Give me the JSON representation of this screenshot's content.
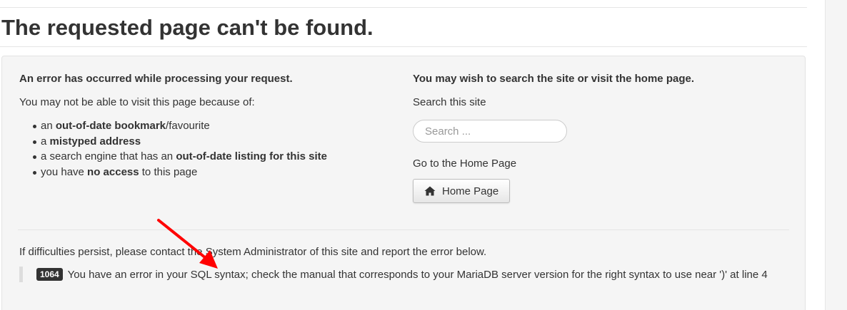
{
  "page": {
    "title": "The requested page can't be found."
  },
  "left_column": {
    "heading": "An error has occurred while processing your request.",
    "intro": "You may not be able to visit this page because of:",
    "reasons": [
      {
        "pre": "an ",
        "bold": "out-of-date bookmark",
        "post": "/favourite"
      },
      {
        "pre": "a ",
        "bold": "mistyped address",
        "post": ""
      },
      {
        "pre": "a search engine that has an ",
        "bold": "out-of-date listing for this site",
        "post": ""
      },
      {
        "pre": "you have ",
        "bold": "no access",
        "post": " to this page"
      }
    ]
  },
  "right_column": {
    "heading": "You may wish to search the site or visit the home page.",
    "search_label": "Search this site",
    "search_placeholder": "Search ...",
    "home_label": "Go to the Home Page",
    "home_button_label": "Home Page",
    "home_button_icon": "home-icon"
  },
  "footer": {
    "persist_text": "If difficulties persist, please contact the System Administrator of this site and report the error below.",
    "error_code": "1064",
    "error_message": "You have an error in your SQL syntax; check the manual that corresponds to your MariaDB server version for the right syntax to use near ')' at line 4"
  },
  "annotation": {
    "arrow_color": "#ff0000"
  }
}
